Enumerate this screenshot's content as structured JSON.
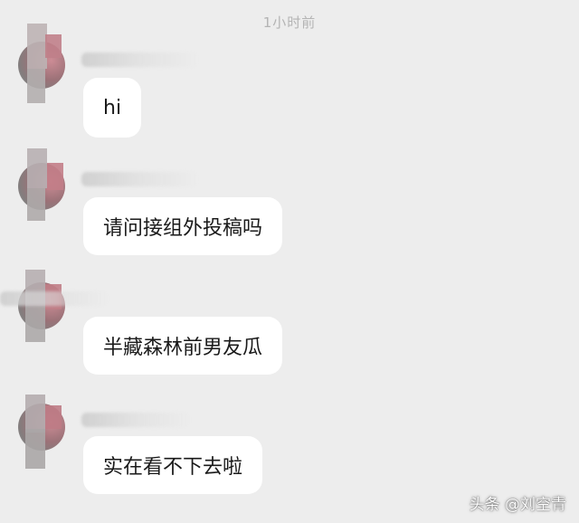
{
  "chat": {
    "timestamp": "1小时前",
    "messages": [
      {
        "text": "hi"
      },
      {
        "text": "请问接组外投稿吗"
      },
      {
        "text": "半藏森林前男友瓜"
      },
      {
        "text": "实在看不下去啦"
      }
    ]
  },
  "watermark": "头条 @刘空青",
  "colors": {
    "background": "#ededed",
    "bubble": "#ffffff",
    "timestamp": "#b4b4b4"
  }
}
